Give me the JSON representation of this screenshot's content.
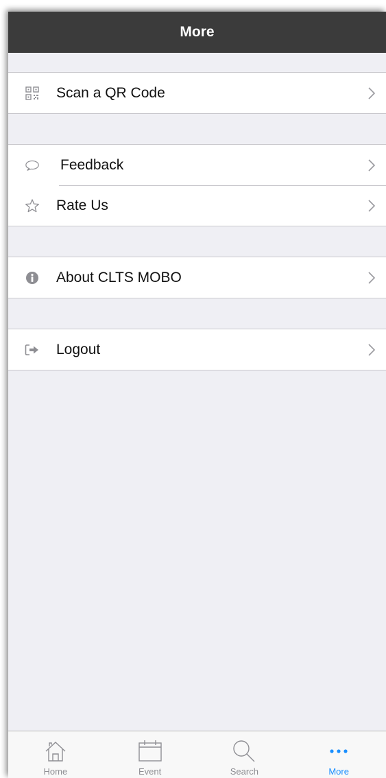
{
  "header": {
    "title": "More"
  },
  "groups": [
    {
      "items": [
        {
          "label": "Scan a QR Code",
          "icon": "qr-code-icon"
        }
      ]
    },
    {
      "items": [
        {
          "label": "Feedback",
          "icon": "speech-bubble-icon"
        },
        {
          "label": "Rate Us",
          "icon": "star-icon"
        }
      ]
    },
    {
      "items": [
        {
          "label": "About CLTS MOBO",
          "icon": "info-icon"
        }
      ]
    },
    {
      "items": [
        {
          "label": "Logout",
          "icon": "logout-icon"
        }
      ]
    }
  ],
  "tabbar": {
    "tabs": [
      {
        "label": "Home",
        "icon": "home-icon"
      },
      {
        "label": "Event",
        "icon": "calendar-icon"
      },
      {
        "label": "Search",
        "icon": "search-icon"
      },
      {
        "label": "More",
        "icon": "more-dots-icon",
        "active": true
      }
    ]
  },
  "colors": {
    "navbar": "#3b3b3b",
    "background": "#efeff4",
    "active_tab": "#1a8fff",
    "inactive_tab": "#8e8e93"
  }
}
